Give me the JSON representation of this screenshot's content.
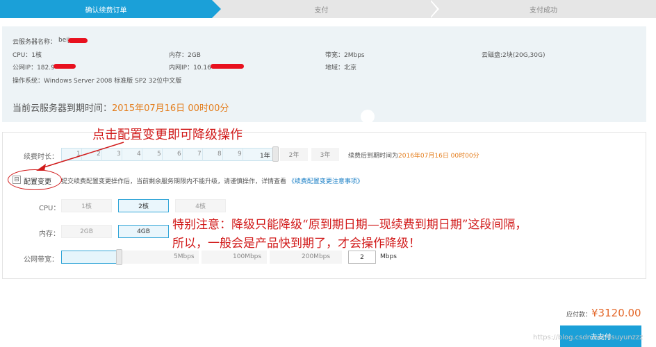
{
  "steps": [
    "确认续费订单",
    "支付",
    "支付成功"
  ],
  "server": {
    "name_label": "云服务器名称：",
    "name_value": "beij",
    "cpu": "CPU：1核",
    "memory": "内存：2GB",
    "bandwidth": "带宽：2Mbps",
    "disk": "云磁盘:2块(20G,30G)",
    "public_ip": "公网IP：182.9",
    "private_ip": "内网IP：10.16",
    "region": "地域：北京",
    "os": "操作系统：Windows Server 2008 标准版 SP2 32位中文版",
    "expire_label": "当前云服务器到期时间：",
    "expire_value": "2015年07月16日 00时00分"
  },
  "renew": {
    "label": "续费时长：",
    "months": [
      "1",
      "2",
      "3",
      "4",
      "5",
      "6",
      "7",
      "8",
      "9"
    ],
    "year_selected": "1年",
    "years": [
      "2年",
      "3年"
    ],
    "note_prefix": "续费后到期时间为",
    "note_date": "2016年07月16日 00时00分"
  },
  "config_change": {
    "toggle_icon": "⊟",
    "label": "配置变更",
    "desc": "提交续费配置变更操作后，当前剩余服务期限内不能升级，请谨慎操作，详情查看",
    "link": "《续费配置变更注意事项》"
  },
  "cpu": {
    "label": "CPU：",
    "options": [
      "1核",
      "2核",
      "4核"
    ],
    "selected": "2核"
  },
  "memory": {
    "label": "内存：",
    "options": [
      "2GB",
      "4GB"
    ],
    "selected": "4GB"
  },
  "net_bandwidth": {
    "label": "公网带宽：",
    "marks": [
      "5Mbps",
      "100Mbps",
      "200Mbps"
    ],
    "value": "2",
    "unit": "Mbps"
  },
  "annotations": {
    "a1": "点击配置变更即可降级操作",
    "a2_line1": "特别注意：降级只能降级“原到期日期—现续费到期日期”这段间隔，",
    "a2_line2": "所以，一般会是产品快到期了，才会操作降级！"
  },
  "footer": {
    "due_label": "应付款：",
    "due_amount": "¥3120.00",
    "pay_button": "去支付",
    "watermark": "https://blog.csdn.net/lisuyunzzz"
  },
  "colors": {
    "accent": "#1ba0d8",
    "annotation": "#d11a1a",
    "price": "#e4682a"
  }
}
